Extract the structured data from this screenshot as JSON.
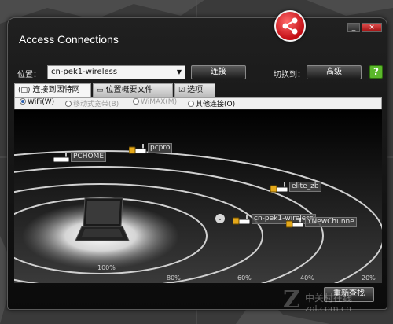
{
  "window": {
    "title": "Access Connections",
    "controls": [
      "_",
      "×"
    ]
  },
  "location": {
    "label": "位置：",
    "selected": "cn-pek1-wireless",
    "connect_label": "连接",
    "switch_label": "切换到：",
    "advanced_label": "高级",
    "help_glyph": "?"
  },
  "tabs": [
    {
      "label": "连接到因特网",
      "icon": "monitor-icon",
      "active": true
    },
    {
      "label": "位置概要文件",
      "icon": "profile-icon",
      "active": false
    },
    {
      "label": "选项",
      "icon": "checkbox-icon",
      "active": false
    }
  ],
  "connection_types": [
    {
      "label": "WiFi(W)",
      "selected": true,
      "enabled": true
    },
    {
      "label": "移动式宽带(B)",
      "selected": false,
      "enabled": false
    },
    {
      "label": "WiMAX(M)",
      "selected": false,
      "enabled": false
    },
    {
      "label": "其他连接(O)",
      "selected": false,
      "enabled": true
    }
  ],
  "access_points": [
    {
      "name": "PCHOME",
      "secured": false
    },
    {
      "name": "pcpro",
      "secured": true
    },
    {
      "name": "elite_zb",
      "secured": true
    },
    {
      "name": "cn-pek1-wireless",
      "secured": true
    },
    {
      "name": "YNewChunne",
      "secured": true
    }
  ],
  "signal_rings": [
    "100%",
    "80%",
    "60%",
    "40%",
    "20%"
  ],
  "expand_glyph": "⌄",
  "rescan_label": "重新查找",
  "watermark": {
    "letter": "Z",
    "text": "中关村在线",
    "url": "zol.com.cn"
  },
  "colors": {
    "logo_red": "#c20d14",
    "help_green": "#5bb82b",
    "ring": "#d0d0d0"
  }
}
